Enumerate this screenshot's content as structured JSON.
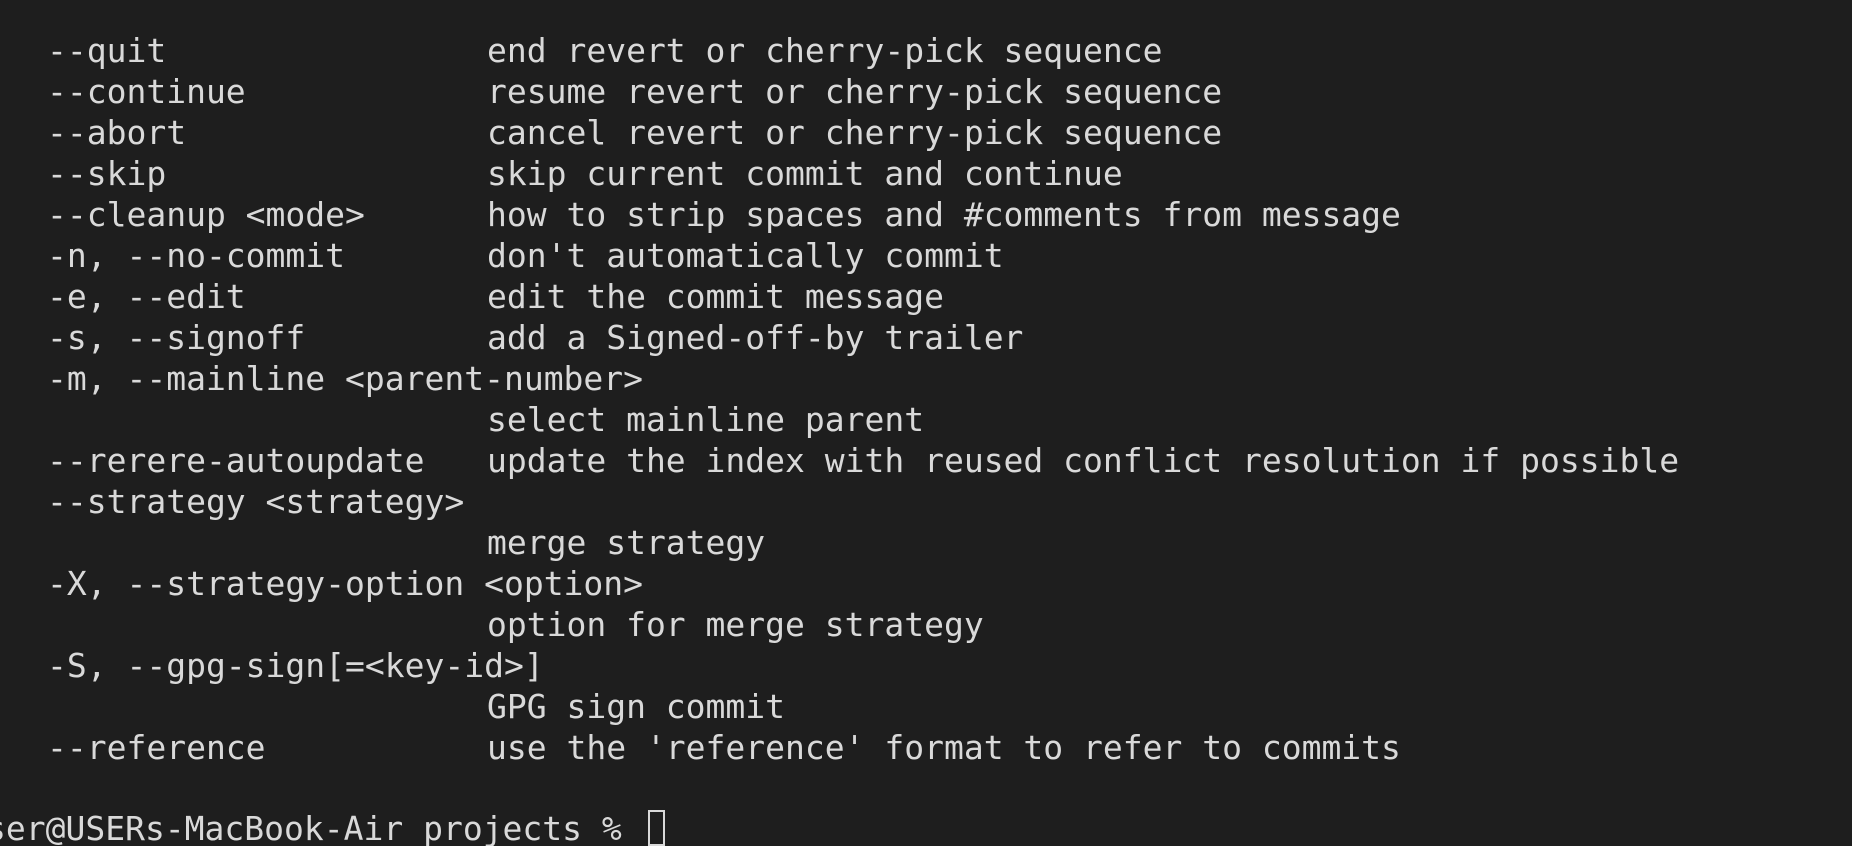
{
  "terminal": {
    "lines": [
      {
        "option": "--quit",
        "description": "end revert or cherry-pick sequence"
      },
      {
        "option": "--continue",
        "description": "resume revert or cherry-pick sequence"
      },
      {
        "option": "--abort",
        "description": "cancel revert or cherry-pick sequence"
      },
      {
        "option": "--skip",
        "description": "skip current commit and continue"
      },
      {
        "option": "--cleanup <mode>",
        "description": "how to strip spaces and #comments from message"
      },
      {
        "option": "-n, --no-commit",
        "description": "don't automatically commit"
      },
      {
        "option": "-e, --edit",
        "description": "edit the commit message"
      },
      {
        "option": "-s, --signoff",
        "description": "add a Signed-off-by trailer"
      },
      {
        "option": "-m, --mainline <parent-number>",
        "description": ""
      },
      {
        "option": "",
        "description": "select mainline parent"
      },
      {
        "option": "--rerere-autoupdate",
        "description": "update the index with reused conflict resolution if possible"
      },
      {
        "option": "--strategy <strategy>",
        "description": ""
      },
      {
        "option": "",
        "description": "merge strategy"
      },
      {
        "option": "-X, --strategy-option <option>",
        "description": ""
      },
      {
        "option": "",
        "description": "option for merge strategy"
      },
      {
        "option": "-S, --gpg-sign[=<key-id>]",
        "description": ""
      },
      {
        "option": "",
        "description": "GPG sign commit"
      },
      {
        "option": "--reference",
        "description": "use the 'reference' format to refer to commits"
      }
    ],
    "prompt": "ser@USERs-MacBook-Air projects % "
  }
}
